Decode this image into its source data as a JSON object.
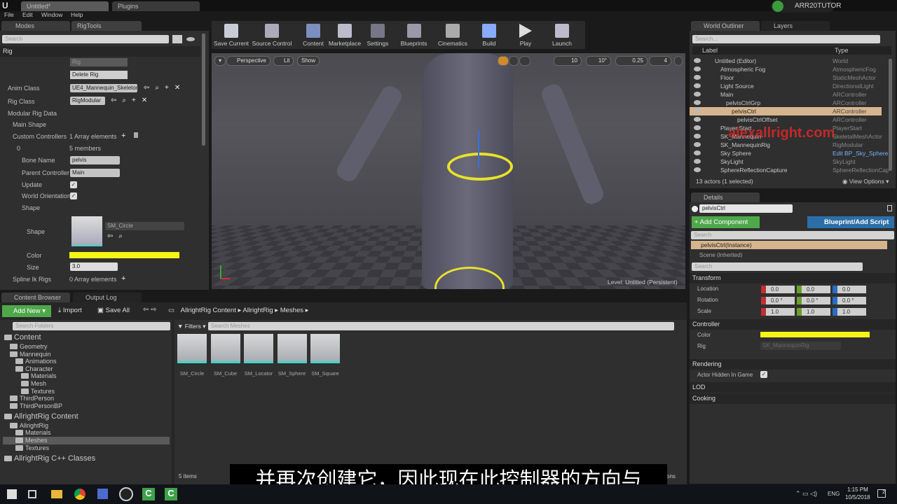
{
  "window": {
    "tabs": [
      "Untitled*",
      "Plugins"
    ],
    "user": "ARR20TUTOR"
  },
  "menu": [
    "File",
    "Edit",
    "Window",
    "Help"
  ],
  "left": {
    "tabs": [
      "Modes",
      "RigTools"
    ],
    "search": "Search",
    "section": "Rig",
    "rig_field": "Rig",
    "delete_rig": "Delete Rig",
    "anim_class_label": "Anim Class",
    "anim_class": "UE4_Mannequin_Skeleton",
    "rig_class_label": "Rig Class",
    "rig_class": "RigModular",
    "modular": "Modular Rig Data",
    "main_shape": "Main Shape",
    "custom": "Custom Controllers",
    "custom_val": "1 Array elements",
    "idx": "0",
    "members": "5 members",
    "bone_label": "Bone Name",
    "bone": "pelvis",
    "parent_label": "Parent Controller",
    "parent": "Main",
    "update": "Update",
    "world_orient": "World Orientation",
    "shape_group": "Shape",
    "shape_label": "Shape",
    "shape": "SM_Circle",
    "color": "Color",
    "color_hex": "#f5f516",
    "size_label": "Size",
    "size": "3.0",
    "spline": "Spline Ik Rigs",
    "spline_val": "0 Array elements"
  },
  "toolbar": [
    "Save Current",
    "Source Control",
    "Content",
    "Marketplace",
    "Settings",
    "Blueprints",
    "Cinematics",
    "Build",
    "Play",
    "Launch"
  ],
  "viewport": {
    "perspective": "Perspective",
    "lit": "Lit",
    "show": "Show",
    "grid": "10",
    "angle": "10°",
    "scale": "0.25",
    "speed": "4",
    "level_label": "Level:",
    "level": "Untitled (Persistent)"
  },
  "outliner": {
    "tabs": [
      "World Outliner",
      "Layers"
    ],
    "search": "Search...",
    "col_label": "Label",
    "col_type": "Type",
    "rows": [
      [
        "Untitled (Editor)",
        "World"
      ],
      [
        "Atmospheric Fog",
        "AtmosphericFog"
      ],
      [
        "Floor",
        "StaticMeshActor"
      ],
      [
        "Light Source",
        "DirectionalLight"
      ],
      [
        "Main",
        "ARController"
      ],
      [
        "pelvisCtrlGrp",
        "ARController"
      ],
      [
        "pelvisCtrl",
        "ARController"
      ],
      [
        "pelvisCtrlOffset",
        "ARController"
      ],
      [
        "Player Start",
        "PlayerStart"
      ],
      [
        "SK_Mannequin",
        "SkeletalMeshActor"
      ],
      [
        "SK_MannequinRig",
        "RigModular"
      ],
      [
        "Sky Sphere",
        "Edit BP_Sky_Sphere"
      ],
      [
        "SkyLight",
        "SkyLight"
      ],
      [
        "SphereReflectionCapture",
        "SphereReflectionCapture"
      ]
    ],
    "status": "13 actors (1 selected)",
    "view_options": "View Options",
    "watermark": "alexallright.com"
  },
  "details": {
    "tab": "Details",
    "name": "pelvisCtrl",
    "add": "+ Add Component",
    "bp": "Blueprint/Add Script",
    "search": "Search",
    "instance": "pelvisCtrl(Instance)",
    "scene": "Scene (Inherited)",
    "transform": "Transform",
    "location": "Location",
    "rotation": "Rotation",
    "scale": "Scale",
    "loc": [
      "0.0",
      "0.0",
      "0.0"
    ],
    "rot": [
      "0.0 °",
      "0.0 °",
      "0.0 °"
    ],
    "scl": [
      "1.0",
      "1.0",
      "1.0"
    ],
    "controller": "Controller",
    "color": "Color",
    "rig": "Rig",
    "rig_val": "SK_MannequinRig",
    "rendering": "Rendering",
    "hidden": "Actor Hidden In Game",
    "lod": "LOD",
    "cooking": "Cooking"
  },
  "content": {
    "tabs": [
      "Content Browser",
      "Output Log"
    ],
    "add_new": "Add New",
    "import": "Import",
    "save_all": "Save All",
    "path": [
      "AllrightRig Content",
      "AllrightRig",
      "Meshes"
    ],
    "search_folders": "Search Folders",
    "filters": "Filters",
    "search_meshes": "Search Meshes",
    "folders": [
      "Content",
      "Geometry",
      "Mannequin",
      "Animations",
      "Character",
      "Materials",
      "Mesh",
      "Textures",
      "ThirdPerson",
      "ThirdPersonBP",
      "AllrightRig Content",
      "AllrightRig",
      "Materials",
      "Meshes",
      "Textures",
      "AllrightRig C++ Classes"
    ],
    "assets": [
      "SM_Circle",
      "SM_Cube",
      "SM_Locator",
      "SM_Sphere",
      "SM_Square"
    ],
    "count": "5 items",
    "view_options": "ons"
  },
  "subtitle": "并再次创建它，因此现在此控制器的方向与",
  "taskbar": {
    "lang": "ENG",
    "time": "1:15 PM",
    "date": "10/5/2018",
    "notif": "2"
  }
}
